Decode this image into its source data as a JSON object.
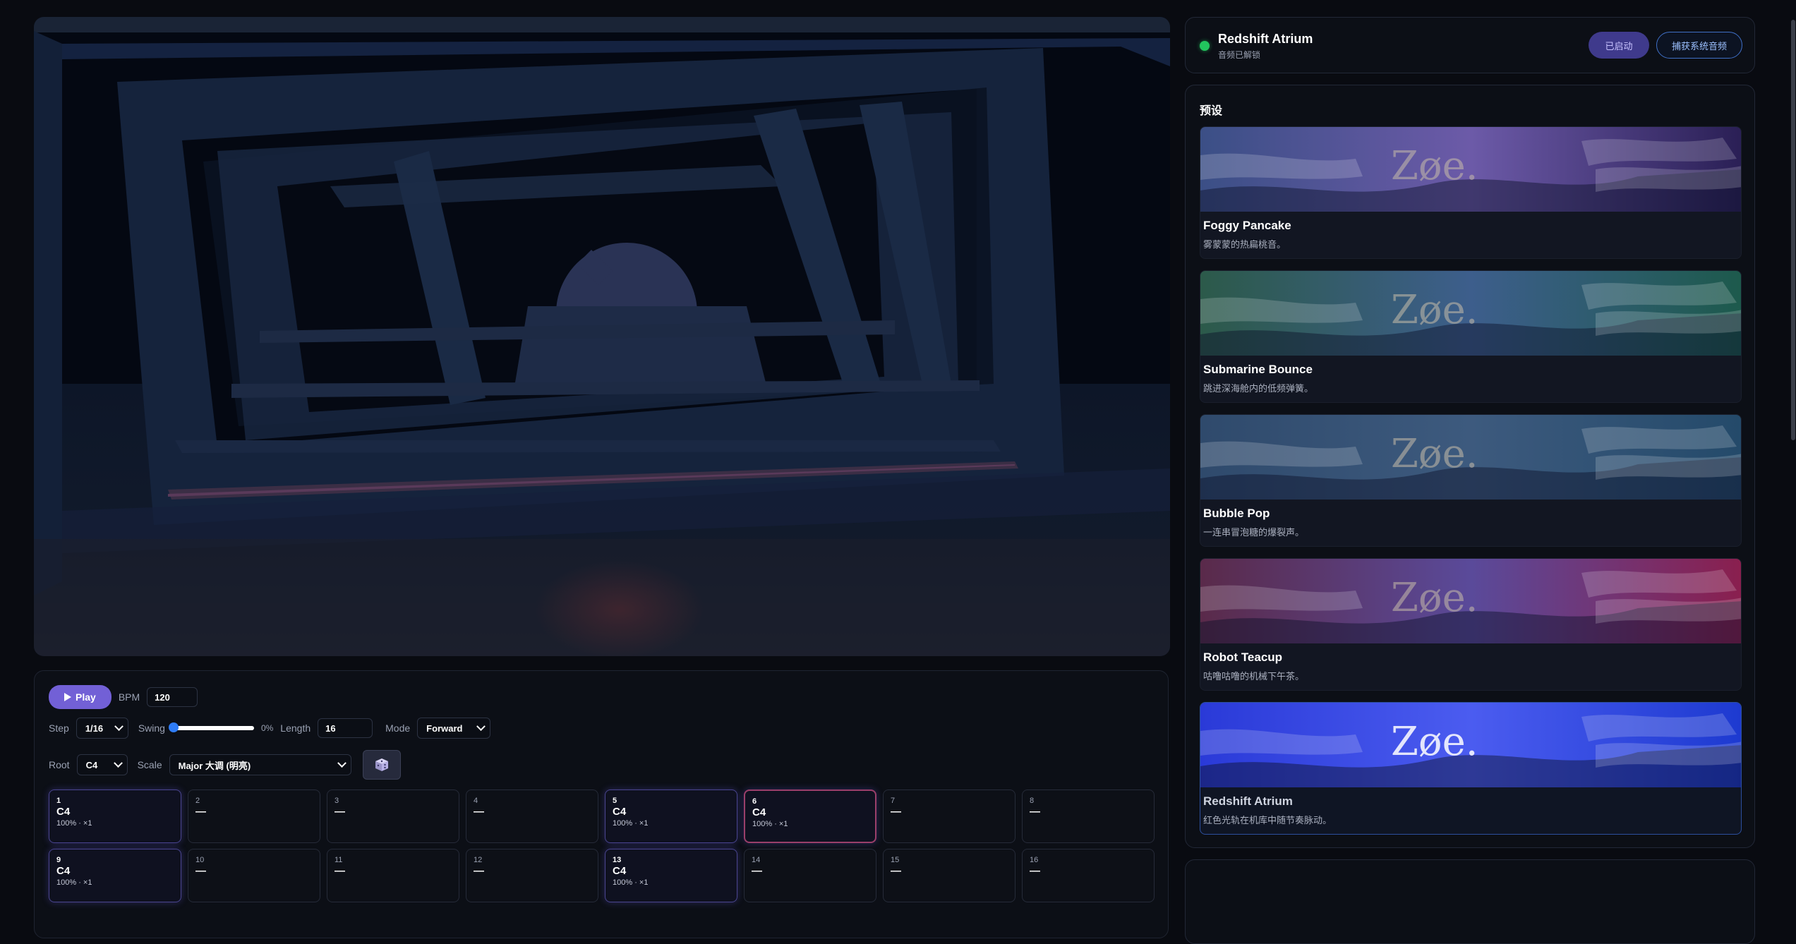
{
  "transport": {
    "play_label": "Play",
    "bpm_label": "BPM",
    "bpm_value": "120"
  },
  "params": {
    "step_label": "Step",
    "step_value": "1/16",
    "swing_label": "Swing",
    "swing_value": "0%",
    "swing_fraction": 0,
    "length_label": "Length",
    "length_value": "16",
    "mode_label": "Mode",
    "mode_value": "Forward",
    "root_label": "Root",
    "root_value": "C4",
    "scale_label": "Scale",
    "scale_value": "Major 大调 (明亮)",
    "random_icon": "dice-icon"
  },
  "steps": [
    {
      "num": "1",
      "note": "C4",
      "meta": "100% · ×1",
      "active": true,
      "current": false
    },
    {
      "num": "2",
      "note": "—",
      "meta": "",
      "active": false,
      "current": false
    },
    {
      "num": "3",
      "note": "—",
      "meta": "",
      "active": false,
      "current": false
    },
    {
      "num": "4",
      "note": "—",
      "meta": "",
      "active": false,
      "current": false
    },
    {
      "num": "5",
      "note": "C4",
      "meta": "100% · ×1",
      "active": true,
      "current": false
    },
    {
      "num": "6",
      "note": "C4",
      "meta": "100% · ×1",
      "active": true,
      "current": true
    },
    {
      "num": "7",
      "note": "—",
      "meta": "",
      "active": false,
      "current": false
    },
    {
      "num": "8",
      "note": "—",
      "meta": "",
      "active": false,
      "current": false
    },
    {
      "num": "9",
      "note": "C4",
      "meta": "100% · ×1",
      "active": true,
      "current": false
    },
    {
      "num": "10",
      "note": "—",
      "meta": "",
      "active": false,
      "current": false
    },
    {
      "num": "11",
      "note": "—",
      "meta": "",
      "active": false,
      "current": false
    },
    {
      "num": "12",
      "note": "—",
      "meta": "",
      "active": false,
      "current": false
    },
    {
      "num": "13",
      "note": "C4",
      "meta": "100% · ×1",
      "active": true,
      "current": false
    },
    {
      "num": "14",
      "note": "—",
      "meta": "",
      "active": false,
      "current": false
    },
    {
      "num": "15",
      "note": "—",
      "meta": "",
      "active": false,
      "current": false
    },
    {
      "num": "16",
      "note": "—",
      "meta": "",
      "active": false,
      "current": false
    }
  ],
  "status": {
    "title": "Redshift Atrium",
    "subtitle": "音频已解锁",
    "started_label": "已启动",
    "capture_label": "捕获系统音频",
    "indicator_color": "#22c55e"
  },
  "presets": {
    "heading": "预设",
    "items": [
      {
        "name": "Foggy Pancake",
        "desc": "雾蒙蒙的热扁桃音。",
        "logo": "Zøe.",
        "colors": [
          "#3b4f86",
          "#6c5aa8",
          "#2a1f55"
        ],
        "active": false
      },
      {
        "name": "Submarine Bounce",
        "desc": "跳进深海舱内的低频弹簧。",
        "logo": "Zøe.",
        "colors": [
          "#2c5a4a",
          "#3d5e8c",
          "#1d5a4c"
        ],
        "active": false
      },
      {
        "name": "Bubble Pop",
        "desc": "一连串冒泡糖的爆裂声。",
        "logo": "Zøe.",
        "colors": [
          "#2f4a6c",
          "#3d5a7e",
          "#244a6a"
        ],
        "active": false
      },
      {
        "name": "Robot Teacup",
        "desc": "咕噜咕噜的机械下午茶。",
        "logo": "Zøe.",
        "colors": [
          "#5a2a4a",
          "#5a4a9a",
          "#8a1f4e"
        ],
        "active": false
      },
      {
        "name": "Redshift Atrium",
        "desc": "红色光轨在机库中随节奏脉动。",
        "logo": "Zøe.",
        "colors": [
          "#2a3ad8",
          "#4b5cf0",
          "#1d3ad0"
        ],
        "active": true
      }
    ]
  }
}
